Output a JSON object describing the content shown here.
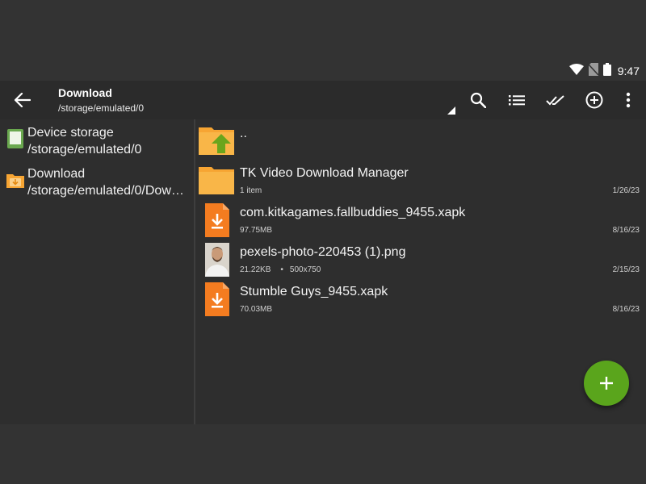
{
  "status_bar": {
    "time": "9:47",
    "icons": [
      "wifi-icon",
      "no-sim-icon",
      "battery-icon"
    ]
  },
  "toolbar": {
    "title": "Download",
    "subtitle": "/storage/emulated/0",
    "actions": [
      "search-icon",
      "list-view-icon",
      "select-all-icon",
      "add-circle-icon",
      "overflow-menu-icon"
    ]
  },
  "sidebar": {
    "items": [
      {
        "label": "Device storage",
        "path": "/storage/emulated/0",
        "icon": "device-storage-icon"
      },
      {
        "label": "Download",
        "path": "/storage/emulated/0/Dow…",
        "icon": "download-folder-icon"
      }
    ]
  },
  "files": [
    {
      "name": "..",
      "meta": "",
      "dims": "",
      "date": "",
      "icon": "parent-folder-icon"
    },
    {
      "name": "TK Video Download Manager",
      "meta": "1 item",
      "dims": "",
      "date": "1/26/23",
      "icon": "folder-icon"
    },
    {
      "name": "com.kitkagames.fallbuddies_9455.xapk",
      "meta": "97.75MB",
      "dims": "",
      "date": "8/16/23",
      "icon": "xapk-file-icon"
    },
    {
      "name": "pexels-photo-220453 (1).png",
      "meta": "21.22KB",
      "dims": "500x750",
      "date": "2/15/23",
      "icon": "image-thumbnail"
    },
    {
      "name": "Stumble Guys_9455.xapk",
      "meta": "70.03MB",
      "dims": "",
      "date": "8/16/23",
      "icon": "xapk-file-icon"
    }
  ],
  "fab": {
    "icon": "plus-icon"
  },
  "colors": {
    "accent": "#5aa51c",
    "folder": "#f7a533",
    "file_orange": "#f47c20",
    "background": "#2e2e2e"
  }
}
